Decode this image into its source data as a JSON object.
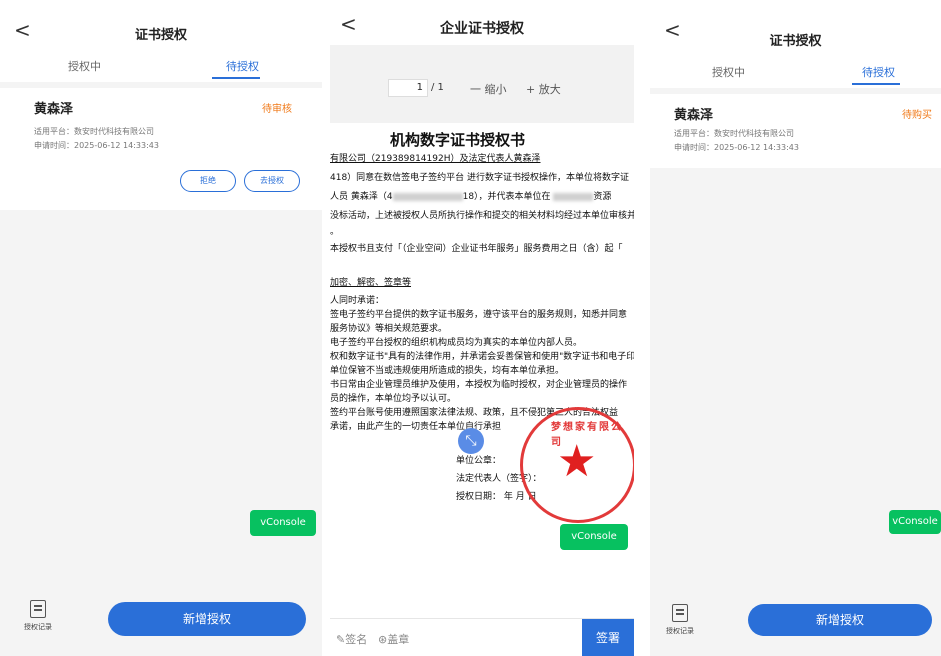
{
  "screen1": {
    "title": "证书授权",
    "tabs": [
      "授权中",
      "待授权"
    ],
    "card": {
      "name": "黄森泽",
      "status": "待审核",
      "platform": "适用平台：数安时代科技有限公司",
      "apply_time": "申请时间：2025-06-12 14:33:43",
      "reject_label": "拒绝",
      "authorize_label": "去授权"
    },
    "vconsole": "vConsole",
    "records_label": "授权记录",
    "add_label": "新增授权"
  },
  "screen2": {
    "title": "企业证书授权",
    "page_current": "1",
    "page_total": "/ 1",
    "zoom_out": "一 缩小",
    "zoom_in": "+ 放大",
    "doc_title": "机构数字证书授权书",
    "lines": {
      "l1": "有限公司（219389814192H）及法定代表人黄森泽",
      "l2": "418）同意在数信签电子签约平台 进行数字证书授权操作，本单位将数字证",
      "l3a": "人员  黄森泽（4",
      "l3b": "18），并代表本单位在",
      "l3c": "资源",
      "l4": "没标活动，上述被授权人员所执行操作和提交的相关材料均经过本单位审核并",
      "l5": "。",
      "l6": "本授权书且支付「（企业空间）企业证书年服务」服务费用之日（含）起「",
      "l7": "加密、解密、签章等",
      "l8": "人同时承诺：",
      "l9": "签电子签约平台提供的数字证书服务，遵守该平台的服务规则，知悉并同意",
      "l10": "服务协议》等相关规范要求。",
      "l11": "电子签约平台授权的组织机构成员均为真实的本单位内部人员。",
      "l12": "权和数字证书\"具有的法律作用，并承诺会妥善保管和使用\"数字证书和电子印",
      "l13": "单位保管不当或违规使用所造成的损失，均有本单位承担。",
      "l14": "书日常由企业管理员维护及使用，本授权为临时授权，对企业管理员的操作",
      "l15": "员的操作，本单位均予以认可。",
      "l16": "签约平台账号使用遵照国家法律法规、政策，且不侵犯第三人的合法权益",
      "l17": "承诺，由此产生的一切责任本单位自行承担",
      "sig1": "单位公章：",
      "sig2": "法定代表人（签字）：",
      "sig3": "授权日期：    年    月    日"
    },
    "seal_text": "梦想家有限公司",
    "vconsole": "vConsole",
    "sign_opt1": "签名",
    "sign_opt2": "盖章",
    "sign_btn": "签署"
  },
  "screen3": {
    "title": "证书授权",
    "tabs": [
      "授权中",
      "待授权"
    ],
    "card": {
      "name": "黄森泽",
      "status": "待购买",
      "platform": "适用平台：数安时代科技有限公司",
      "apply_time": "申请时间：2025-06-12 14:33:43"
    },
    "vconsole": "vConsole",
    "records_label": "授权记录",
    "add_label": "新增授权"
  },
  "colors": {
    "primary": "#2a6fd8",
    "pending": "#f07a1a",
    "seal": "#e23a3a",
    "vconsole": "#07c160"
  }
}
